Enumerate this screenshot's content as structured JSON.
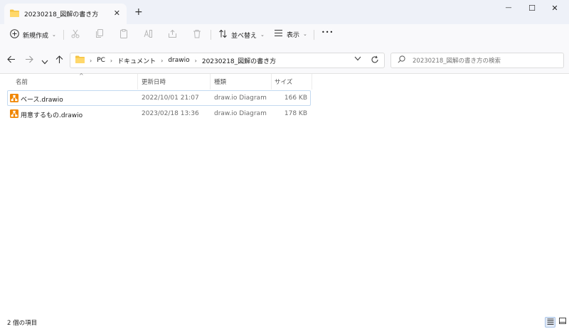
{
  "tab": {
    "title": "20230218_図解の書き方",
    "close_glyph": "✕",
    "new_tab_glyph": "+"
  },
  "window": {
    "minimize_glyph": "—",
    "maximize_glyph": "☐",
    "close_glyph": "✕"
  },
  "toolbar": {
    "new_label": "新規作成",
    "sort_label": "並べ替え",
    "view_label": "表示",
    "more_glyph": "•••"
  },
  "address": {
    "crumbs": [
      "PC",
      "ドキュメント",
      "drawio",
      "20230218_図解の書き方"
    ]
  },
  "search": {
    "placeholder": "20230218_図解の書き方の検索"
  },
  "columns": {
    "name": "名前",
    "date": "更新日時",
    "type": "種類",
    "size": "サイズ"
  },
  "files": [
    {
      "name": "ベース.drawio",
      "date": "2022/10/01 21:07",
      "type": "draw.io Diagram",
      "size": "166 KB"
    },
    {
      "name": "用意するもの.drawio",
      "date": "2023/02/18 13:36",
      "type": "draw.io Diagram",
      "size": "178 KB"
    }
  ],
  "status": {
    "item_count": "2 個の項目"
  },
  "colors": {
    "folder": "#f5c342",
    "drawio_icon": "#f08705",
    "selection_border": "#c3d9f0"
  }
}
